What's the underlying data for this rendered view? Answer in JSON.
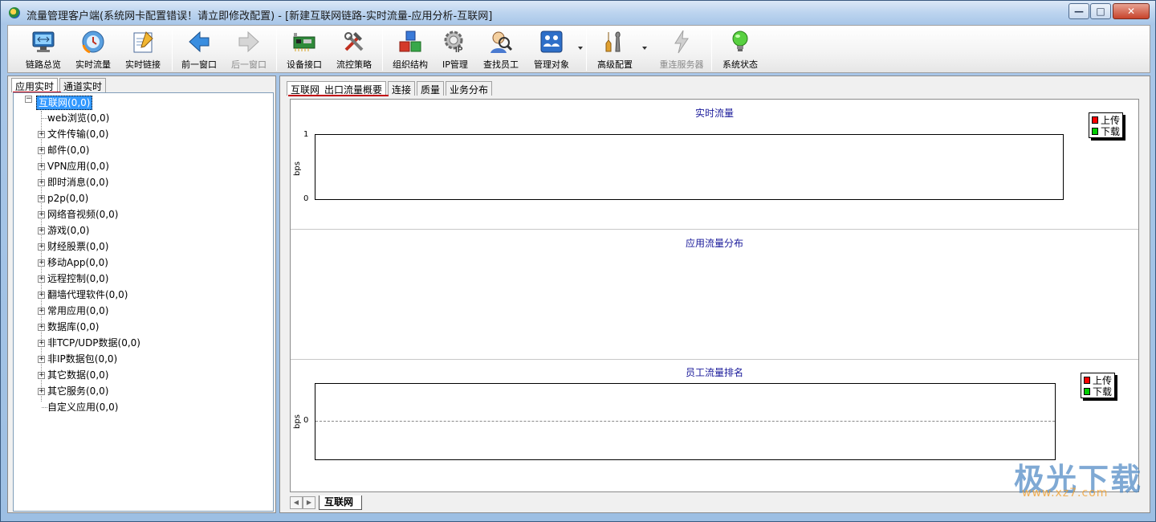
{
  "window": {
    "title": "流量管理客户端(系统网卡配置错误！请立即修改配置) - [新建互联网链路-实时流量-应用分析-互联网]",
    "minimize": "—",
    "maximize": "□",
    "close": "✕"
  },
  "toolbar": {
    "items": [
      {
        "label": "链路总览",
        "icon": "network-overview-icon"
      },
      {
        "label": "实时流量",
        "icon": "realtime-traffic-icon"
      },
      {
        "label": "实时链接",
        "icon": "realtime-link-icon"
      },
      {
        "label": "前一窗口",
        "icon": "back-arrow-icon"
      },
      {
        "label": "后一窗口",
        "icon": "forward-arrow-icon",
        "disabled": true
      },
      {
        "label": "设备接口",
        "icon": "network-card-icon"
      },
      {
        "label": "流控策略",
        "icon": "tools-icon"
      },
      {
        "label": "组织结构",
        "icon": "org-structure-icon"
      },
      {
        "label": "IP管理",
        "icon": "ip-gear-icon"
      },
      {
        "label": "查找员工",
        "icon": "find-user-icon"
      },
      {
        "label": "管理对象",
        "icon": "manage-objects-icon"
      },
      {
        "label": "高级配置",
        "icon": "advanced-config-icon"
      },
      {
        "label": "重连服务器",
        "icon": "reconnect-icon",
        "disabled": true
      },
      {
        "label": "系统状态",
        "icon": "system-status-icon"
      }
    ]
  },
  "left": {
    "tabs": [
      "应用实时",
      "通道实时"
    ],
    "root": "互联网(0,0)",
    "items": [
      "web浏览(0,0)",
      "文件传输(0,0)",
      "邮件(0,0)",
      "VPN应用(0,0)",
      "即时消息(0,0)",
      "p2p(0,0)",
      "网络音视频(0,0)",
      "游戏(0,0)",
      "财经股票(0,0)",
      "移动App(0,0)",
      "远程控制(0,0)",
      "翻墙代理软件(0,0)",
      "常用应用(0,0)",
      "数据库(0,0)",
      "非TCP/UDP数据(0,0)",
      "非IP数据包(0,0)",
      "其它数据(0,0)",
      "其它服务(0,0)",
      "自定义应用(0,0)"
    ]
  },
  "right": {
    "tabs": [
      "互联网_出口流量概要",
      "连接",
      "质量",
      "业务分布"
    ],
    "sheet_tab": "互联网",
    "nav_prev": "◀",
    "nav_next": "▶"
  },
  "chart_data": [
    {
      "type": "line",
      "title": "实时流量",
      "ylabel": "bps",
      "ylim": [
        0,
        1
      ],
      "yticks": [
        "1",
        "0"
      ],
      "series": [
        {
          "name": "上传",
          "color": "#ff0000",
          "values": []
        },
        {
          "name": "下载",
          "color": "#00cc00",
          "values": []
        }
      ]
    },
    {
      "type": "pie",
      "title": "应用流量分布",
      "series": []
    },
    {
      "type": "bar",
      "title": "员工流量排名",
      "ylabel": "bps",
      "yticks": [
        "0"
      ],
      "series": [
        {
          "name": "上传",
          "color": "#ff0000",
          "values": []
        },
        {
          "name": "下载",
          "color": "#00cc00",
          "values": []
        }
      ]
    }
  ],
  "watermark": {
    "text": "极光下载",
    "url": "www.xz7.com"
  }
}
